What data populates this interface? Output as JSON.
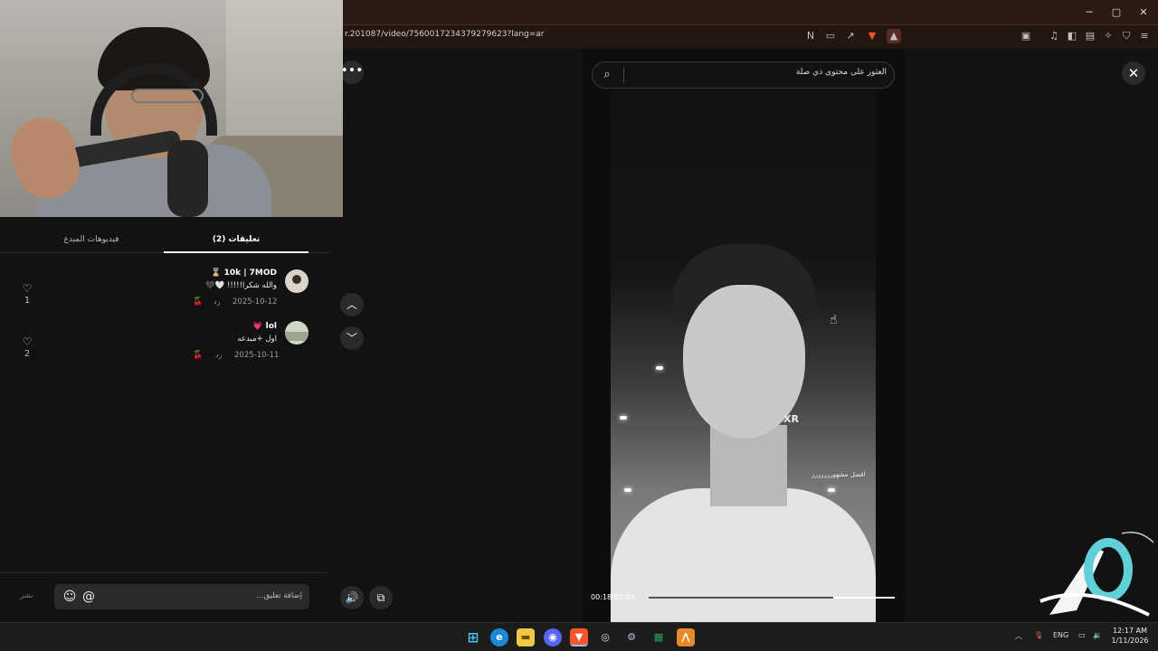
{
  "browser": {
    "url": "r.201087/video/7560017234379279623?lang=ar",
    "window_controls": {
      "minimize": "─",
      "maximize": "▢",
      "close": "✕"
    }
  },
  "panel": {
    "tabs": [
      {
        "label": "(2) تعليقات",
        "active": true
      },
      {
        "label": "فيديوهات المبدع",
        "active": false
      }
    ],
    "comments": [
      {
        "name": "10k | 7MOD ⌛",
        "text": "والله شكرا!!!!! 🤍🖤",
        "date": "2025-10-12",
        "reply": "رد",
        "likes": "1"
      },
      {
        "name": "lol 💗",
        "text": "اول +مبدعه",
        "date": "2025-10-11",
        "reply": "رد",
        "likes": "2"
      }
    ],
    "comment_input": {
      "placeholder": "إضافة تعليق...",
      "post": "نشر"
    }
  },
  "video": {
    "search_placeholder": "العثور على محتوى ذي صلة",
    "overlay_text": "XR",
    "caption": "افضل مشهوررررررر",
    "timecode": "00:18/00:04",
    "progress": 0.75
  },
  "taskbar": {
    "lang": "ENG",
    "time": "12:17 AM",
    "date": "1/11/2026"
  },
  "colors": {
    "accent": "#ffffff",
    "brand_browser": "#fb542b",
    "discord": "#5865f2"
  }
}
